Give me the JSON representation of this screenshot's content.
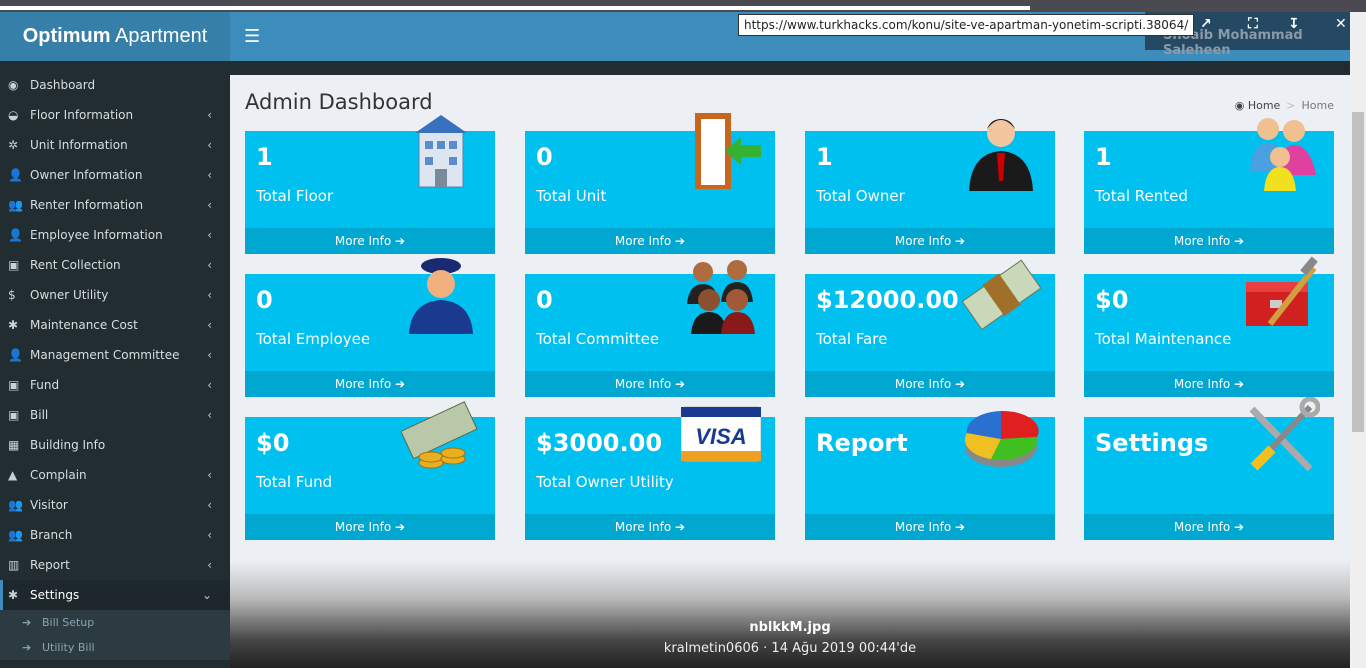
{
  "app": {
    "logo_bold": "Optimum",
    "logo_rest": " Apartment",
    "user": "Shoaib Mohammad Saleheen"
  },
  "overlay": {
    "url": "https://www.turkhacks.com/konu/site-ve-apartman-yonetim-scripti.38064/",
    "filename": "nblkkM.jpg",
    "meta": "kralmetin0606 · 14 Ağu 2019 00:44'de"
  },
  "sidebar": {
    "items": [
      {
        "label": "Dashboard",
        "icon": "dashboard-icon",
        "chev": false
      },
      {
        "label": "Floor Information",
        "icon": "floor-icon",
        "chev": true
      },
      {
        "label": "Unit Information",
        "icon": "unit-icon",
        "chev": true
      },
      {
        "label": "Owner Information",
        "icon": "user-icon",
        "chev": true
      },
      {
        "label": "Renter Information",
        "icon": "users-icon",
        "chev": true
      },
      {
        "label": "Employee Information",
        "icon": "user-icon",
        "chev": true
      },
      {
        "label": "Rent Collection",
        "icon": "money-icon",
        "chev": true
      },
      {
        "label": "Owner Utility",
        "icon": "dollar-icon",
        "chev": true
      },
      {
        "label": "Maintenance Cost",
        "icon": "gear-icon",
        "chev": true
      },
      {
        "label": "Management Committee",
        "icon": "user-icon",
        "chev": true
      },
      {
        "label": "Fund",
        "icon": "money-icon",
        "chev": true
      },
      {
        "label": "Bill",
        "icon": "money-icon",
        "chev": true
      },
      {
        "label": "Building Info",
        "icon": "building-icon",
        "chev": false
      },
      {
        "label": "Complain",
        "icon": "warning-icon",
        "chev": true
      },
      {
        "label": "Visitor",
        "icon": "users-icon",
        "chev": true
      },
      {
        "label": "Branch",
        "icon": "users-icon",
        "chev": true
      },
      {
        "label": "Report",
        "icon": "bar-chart-icon",
        "chev": true
      },
      {
        "label": "Settings",
        "icon": "gear-icon",
        "chev": true,
        "active": true
      }
    ],
    "subitems": [
      "Bill Setup",
      "Utility Bill"
    ]
  },
  "page": {
    "title": "Admin Dashboard",
    "breadcrumb": [
      "Home",
      "Home"
    ]
  },
  "cards": [
    {
      "value": "1",
      "label": "Total Floor",
      "more": "More Info",
      "icon": "building-icon"
    },
    {
      "value": "0",
      "label": "Total Unit",
      "more": "More Info",
      "icon": "door-icon"
    },
    {
      "value": "1",
      "label": "Total Owner",
      "more": "More Info",
      "icon": "businessman-icon"
    },
    {
      "value": "1",
      "label": "Total Rented",
      "more": "More Info",
      "icon": "family-icon"
    },
    {
      "value": "0",
      "label": "Total Employee",
      "more": "More Info",
      "icon": "police-icon"
    },
    {
      "value": "0",
      "label": "Total Committee",
      "more": "More Info",
      "icon": "group-icon"
    },
    {
      "value": "$12000.00",
      "label": "Total Fare",
      "more": "More Info",
      "icon": "cash-icon"
    },
    {
      "value": "$0",
      "label": "Total Maintenance",
      "more": "More Info",
      "icon": "toolbox-icon"
    },
    {
      "value": "$0",
      "label": "Total Fund",
      "more": "More Info",
      "icon": "coins-icon"
    },
    {
      "value": "$3000.00",
      "label": "Total Owner Utility",
      "more": "More Info",
      "icon": "visa-card-icon"
    },
    {
      "value": "Report",
      "label": "",
      "more": "More Info",
      "icon": "pie-chart-icon"
    },
    {
      "value": "Settings",
      "label": "",
      "more": "More Info",
      "icon": "tools-icon"
    }
  ],
  "colors": {
    "card": "#00c0ef",
    "card_footer": "#00a7d0",
    "header": "#3c8dbc",
    "sidebar": "#222d32"
  }
}
